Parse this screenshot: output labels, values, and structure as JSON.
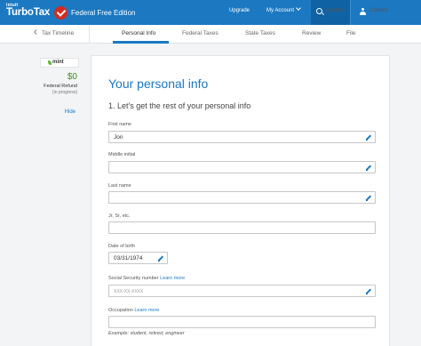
{
  "header": {
    "brand_small": "intuit",
    "brand": "TurboTax",
    "edition": "Federal Free Edition",
    "upgrade": "Upgrade",
    "account": "My Account",
    "search": "Search",
    "contact": "Contact",
    "colors": {
      "bar": "#1b78c1",
      "search_bg": "#0f62a4",
      "logo_check": "#d52b1e"
    }
  },
  "tabs": {
    "back": "Tax Timeline",
    "items": [
      "Personal Info",
      "Federal Taxes",
      "State Taxes",
      "Review",
      "File"
    ],
    "active": "Personal Info"
  },
  "sidebar": {
    "mint": "mint",
    "refund_amount": "$0",
    "refund_label": "Federal Refund",
    "refund_status": "(in progress)",
    "hide": "Hide"
  },
  "form": {
    "title": "Your personal info",
    "subtitle": "1. Let's get the rest of your personal info",
    "first_name": {
      "label": "First name",
      "value": "Jon"
    },
    "middle_initial": {
      "label": "Middle initial",
      "value": ""
    },
    "last_name": {
      "label": "Last name",
      "value": ""
    },
    "suffix": {
      "label": "Jr, Sr, etc.",
      "value": ""
    },
    "dob": {
      "label": "Date of birth",
      "value": "03/31/1974"
    },
    "ssn": {
      "label": "Social Security number",
      "learn_more": "Learn more",
      "placeholder": "XXX-XX-XXXX"
    },
    "occupation": {
      "label": "Occupation",
      "learn_more": "Learn more",
      "example": "Example: student, retired, engineer"
    }
  }
}
